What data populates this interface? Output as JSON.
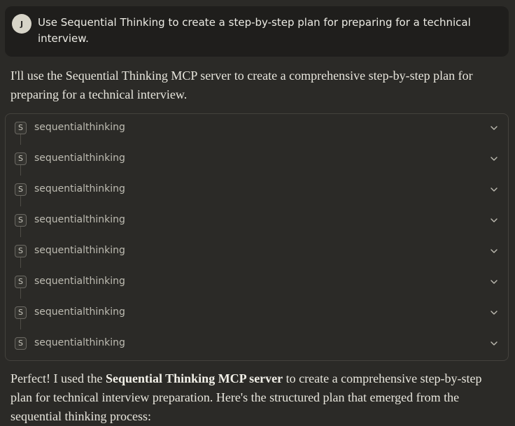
{
  "user_message": {
    "avatar_initial": "J",
    "text": "Use Sequential Thinking to create a step-by-step plan for preparing for a technical interview."
  },
  "assistant": {
    "intro": "I'll use the Sequential Thinking MCP server to create a comprehensive step-by-step plan for preparing for a technical interview.",
    "tool_calls": [
      {
        "badge": "S",
        "name": "sequentialthinking"
      },
      {
        "badge": "S",
        "name": "sequentialthinking"
      },
      {
        "badge": "S",
        "name": "sequentialthinking"
      },
      {
        "badge": "S",
        "name": "sequentialthinking"
      },
      {
        "badge": "S",
        "name": "sequentialthinking"
      },
      {
        "badge": "S",
        "name": "sequentialthinking"
      },
      {
        "badge": "S",
        "name": "sequentialthinking"
      },
      {
        "badge": "S",
        "name": "sequentialthinking"
      }
    ],
    "summary_before": "Perfect! I used the ",
    "summary_bold": "Sequential Thinking MCP server",
    "summary_after": " to create a comprehensive step-by-step plan for technical interview preparation. Here's the structured plan that emerged from the sequential thinking process:"
  },
  "icons": {
    "expand": "chevron-down-icon"
  }
}
